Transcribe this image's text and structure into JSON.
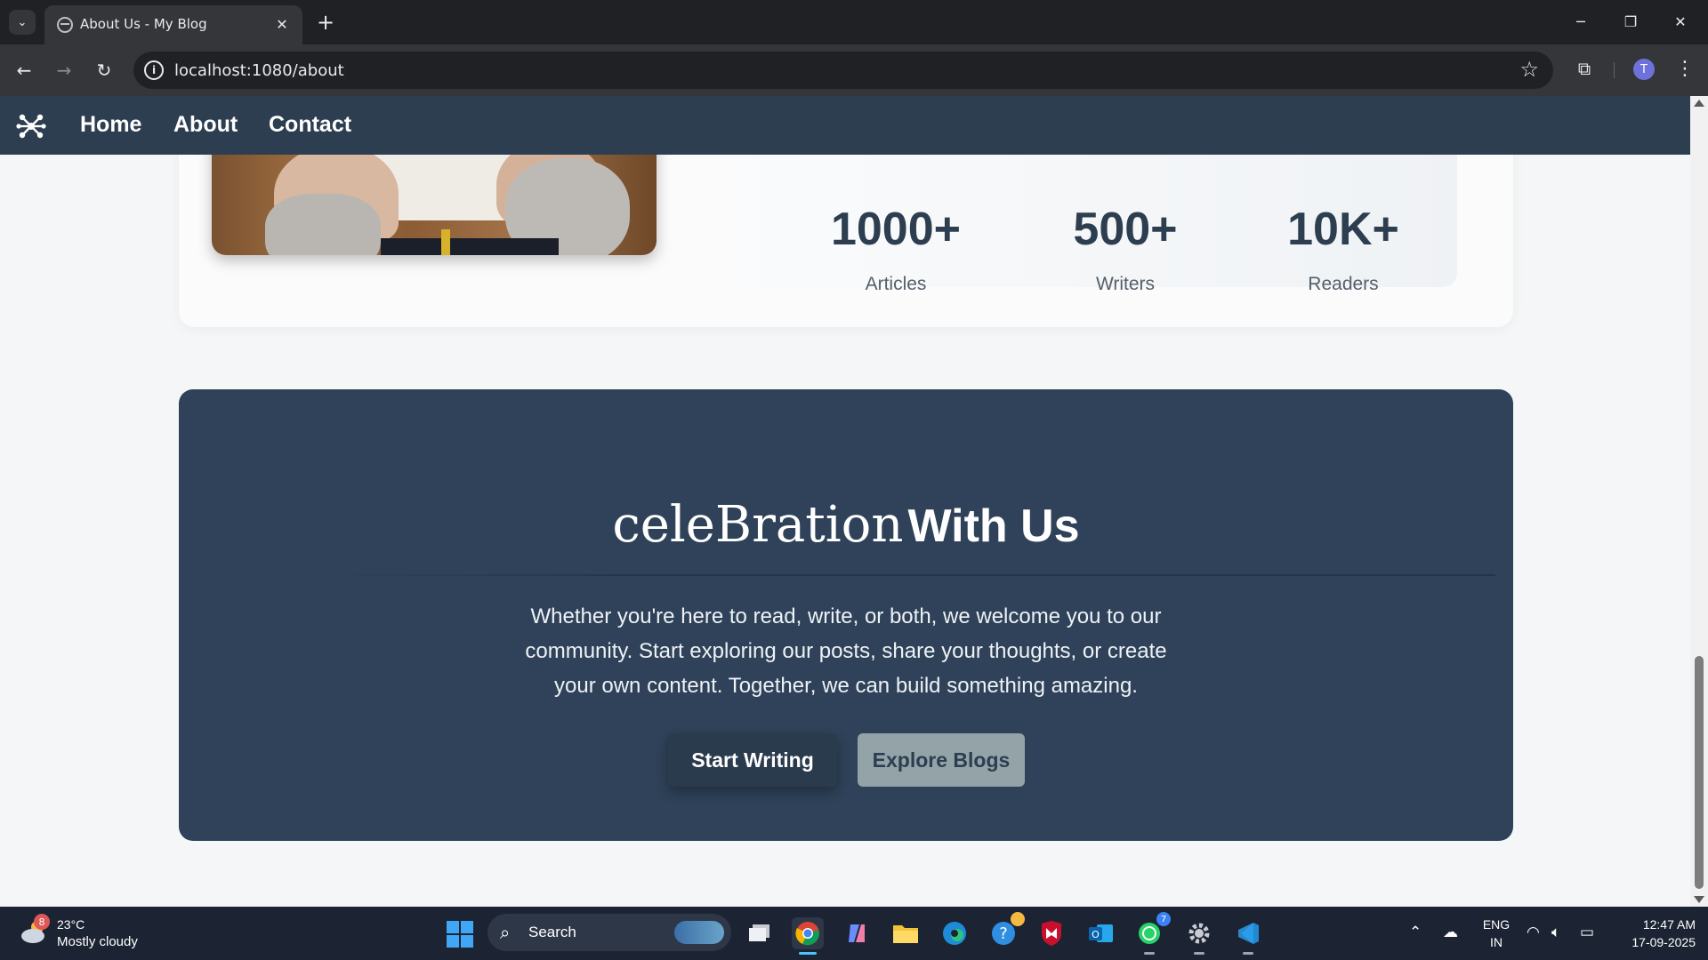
{
  "browser": {
    "tab_title": "About Us - My Blog",
    "url": "localhost:1080/about",
    "profile_initial": "T"
  },
  "site_nav": {
    "links": [
      "Home",
      "About",
      "Contact"
    ]
  },
  "stats": [
    {
      "value": "1000+",
      "label": "Articles"
    },
    {
      "value": "500+",
      "label": "Writers"
    },
    {
      "value": "10K+",
      "label": "Readers"
    }
  ],
  "cta": {
    "title_fancy": "celeBration",
    "title_strong": "With Us",
    "text": "Whether you're here to read, write, or both, we welcome you to our community. Start exploring our posts, share your thoughts, or create your own content. Together, we can build something amazing.",
    "primary_button": "Start Writing",
    "secondary_button": "Explore Blogs"
  },
  "taskbar": {
    "weather_badge": "8",
    "temperature": "23°C",
    "weather": "Mostly cloudy",
    "search_label": "Search",
    "whatsapp_badge": "7",
    "lang_top": "ENG",
    "lang_bottom": "IN",
    "time": "12:47 AM",
    "date": "17-09-2025"
  },
  "colors": {
    "nav_bg": "#2c3e50",
    "cta_bg": "#2f4259",
    "explore_btn": "#94a3a8",
    "stat_text": "#2c3e50"
  },
  "icons": [
    "tab-search-icon",
    "globe-icon",
    "close-icon",
    "plus-icon",
    "back-arrow-icon",
    "forward-arrow-icon",
    "reload-icon",
    "site-info-icon",
    "star-icon",
    "extensions-icon",
    "more-icon",
    "network-logo-icon",
    "weather-cloud-icon",
    "windows-start-icon",
    "search-icon",
    "chrome-icon",
    "file-explorer-icon",
    "edge-icon",
    "wifi-icon",
    "volume-icon",
    "battery-icon"
  ]
}
